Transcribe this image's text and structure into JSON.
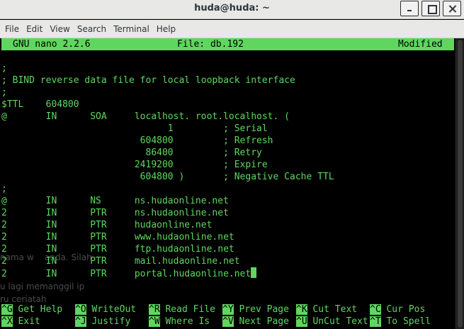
{
  "window": {
    "title": "huda@huda: ~"
  },
  "menu": [
    "File",
    "Edit",
    "View",
    "Search",
    "Terminal",
    "Help"
  ],
  "nano": {
    "version": "GNU nano 2.2.6",
    "file_label": "File: db.192",
    "state": "Modified"
  },
  "file_lines": [
    ";",
    "; BIND reverse data file for local loopback interface",
    ";",
    "$TTL    604800",
    "@       IN      SOA     localhost. root.localhost. (",
    "                              1         ; Serial",
    "                         604800         ; Refresh",
    "                          86400         ; Retry",
    "                        2419200         ; Expire",
    "                         604800 )       ; Negative Cache TTL",
    ";",
    "@       IN      NS      ns.hudaonline.net",
    "2       IN      PTR     ns.hudaonline.net",
    "2       IN      PTR     hudaonline.net",
    "2       IN      PTR     www.hudaonline.net",
    "2       IN      PTR     ftp.hudaonline.net",
    "2       IN      PTR     mail.hudaonline.net",
    "2       IN      PTR     portal.hudaonline.net"
  ],
  "ghost_text": [
    "nama w    anda. Silah",
    "u lagi memanggil ip",
    "ru ceriatah"
  ],
  "shortcuts": [
    {
      "key": "^G",
      "label": "Get Help"
    },
    {
      "key": "^O",
      "label": "WriteOut"
    },
    {
      "key": "^R",
      "label": "Read File"
    },
    {
      "key": "^Y",
      "label": "Prev Page"
    },
    {
      "key": "^K",
      "label": "Cut Text"
    },
    {
      "key": "^C",
      "label": "Cur Pos"
    },
    {
      "key": "^X",
      "label": "Exit"
    },
    {
      "key": "^J",
      "label": "Justify"
    },
    {
      "key": "^W",
      "label": "Where Is"
    },
    {
      "key": "^V",
      "label": "Next Page"
    },
    {
      "key": "^U",
      "label": "UnCut Text"
    },
    {
      "key": "^T",
      "label": "To Spell"
    }
  ]
}
